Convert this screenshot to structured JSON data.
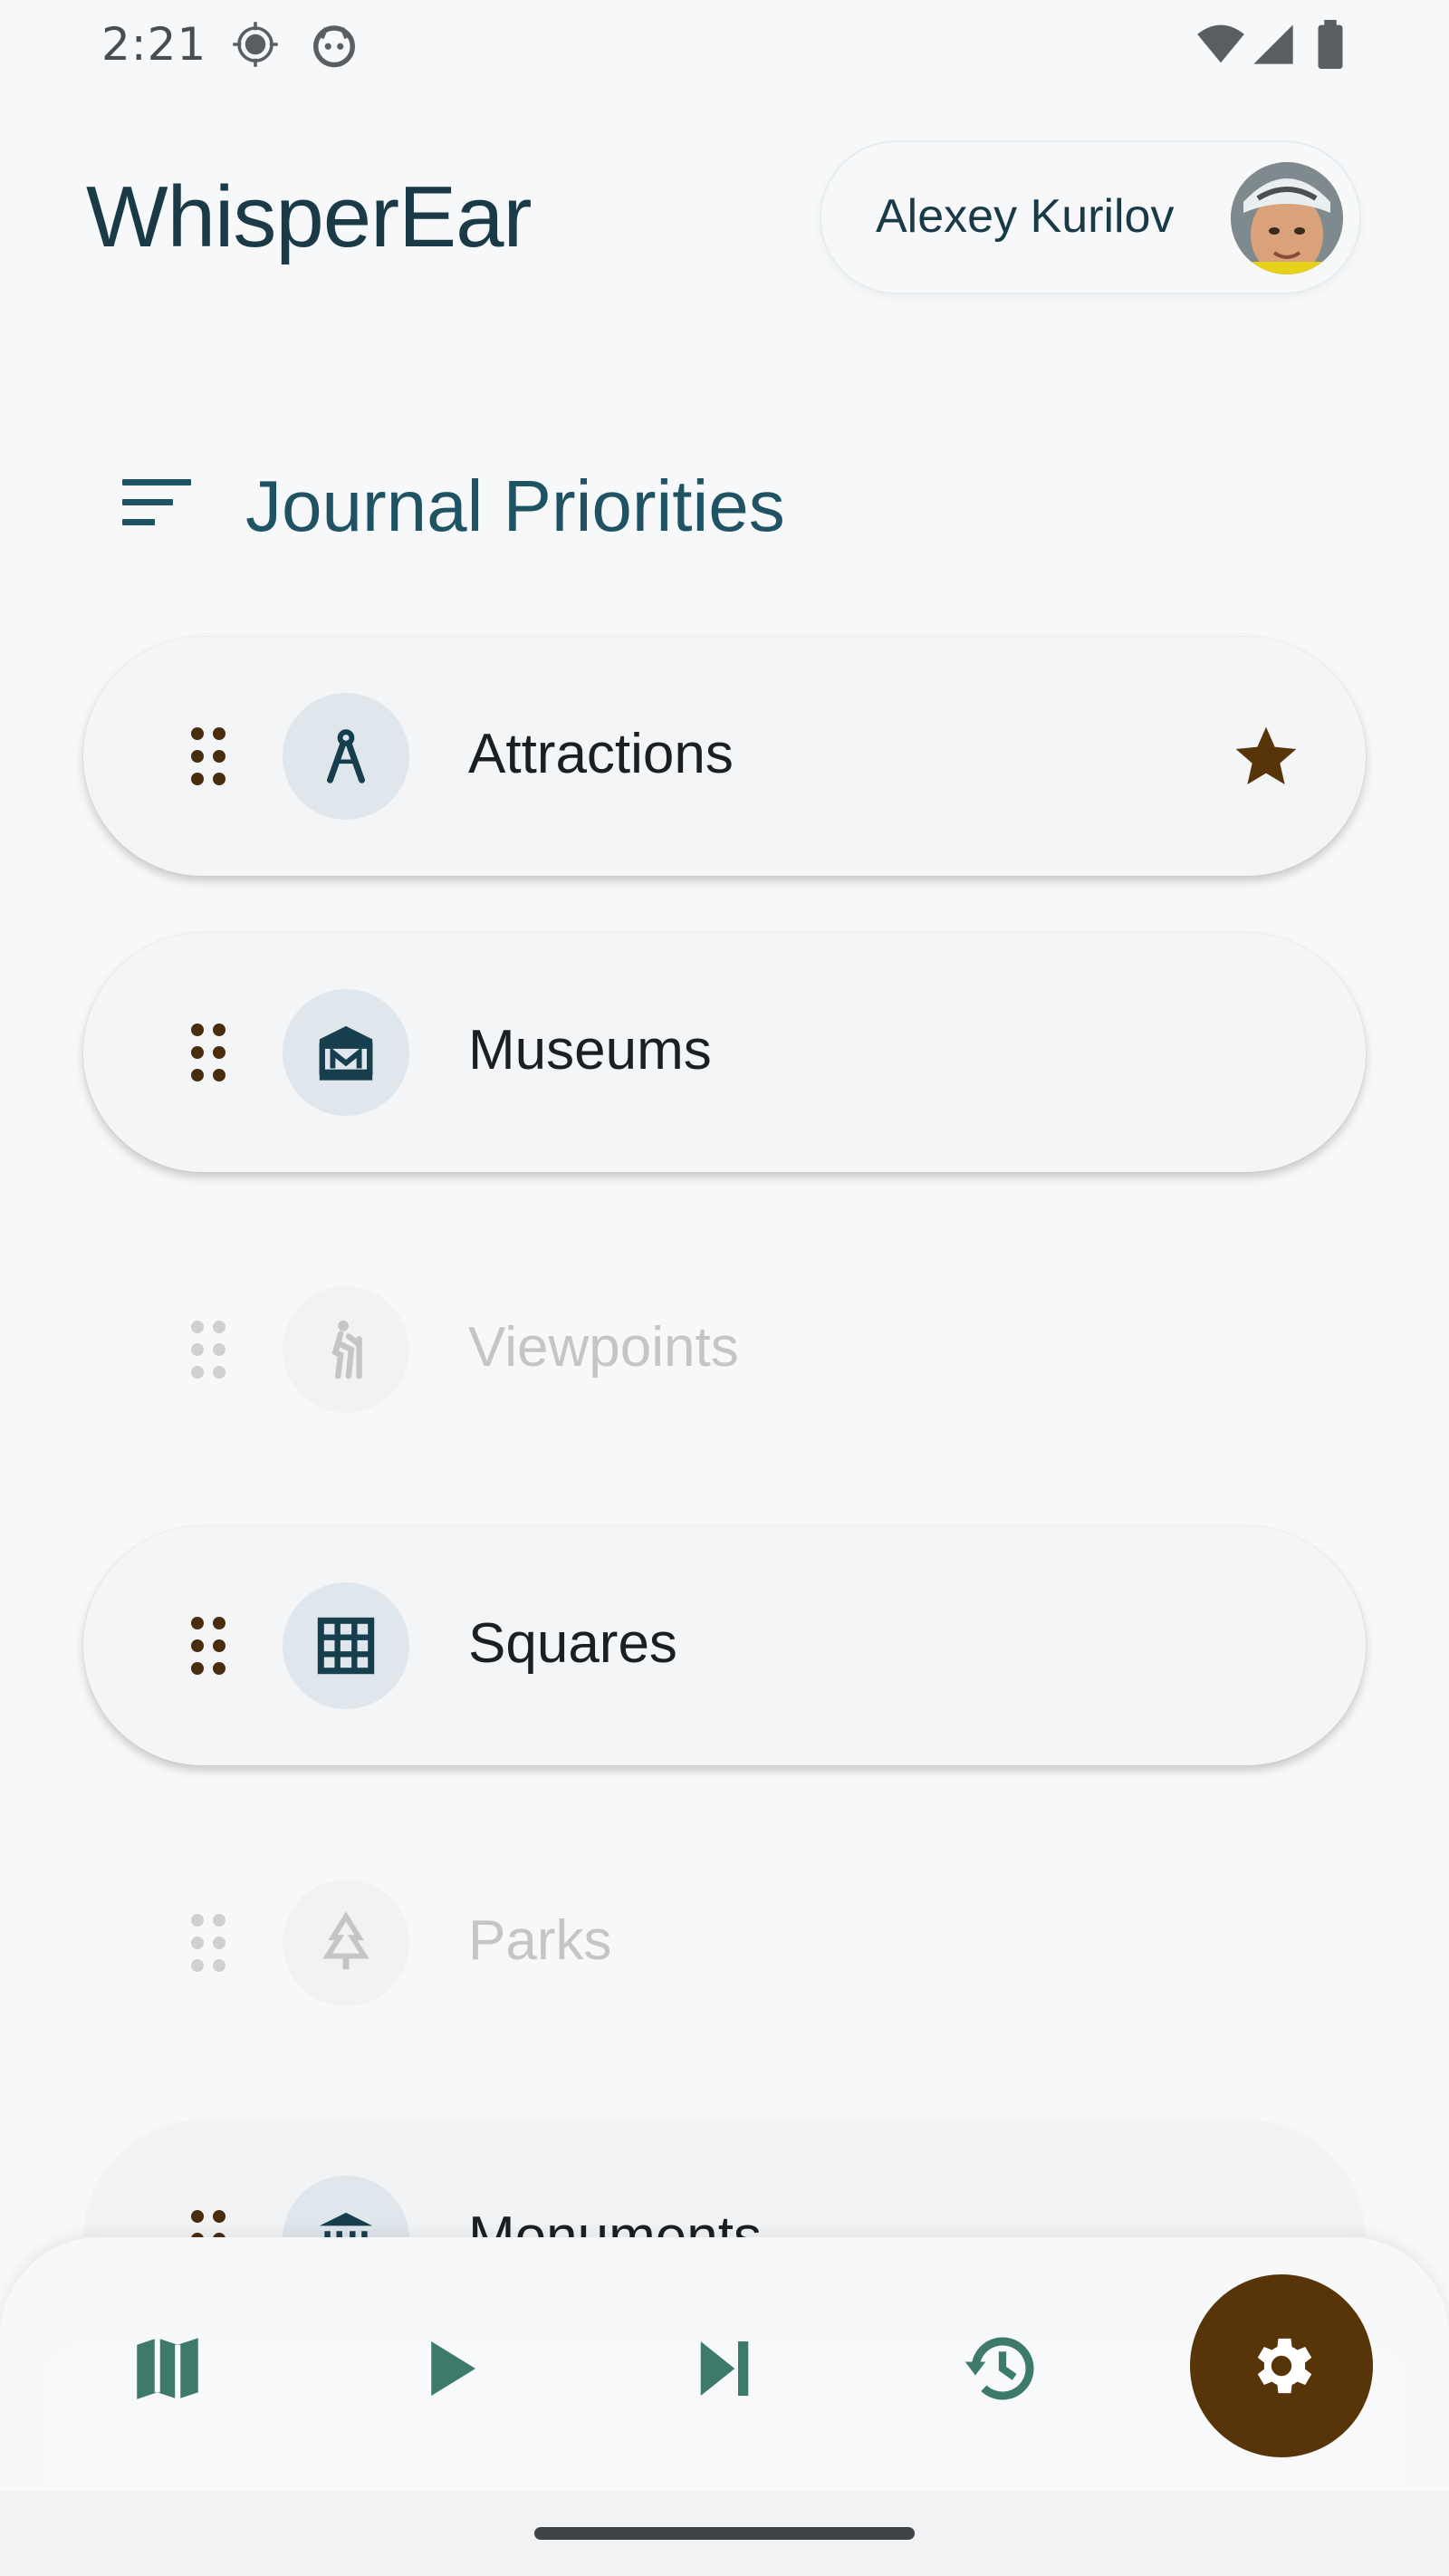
{
  "status_bar": {
    "time": "2:21",
    "icons": [
      "location-icon",
      "android-icon",
      "wifi-icon",
      "signal-icon",
      "battery-icon"
    ]
  },
  "header": {
    "app_title": "WhisperEar",
    "user_name": "Alexey Kurilov",
    "avatar": "avatar"
  },
  "section": {
    "title": "Journal Priorities",
    "icon": "sort-icon"
  },
  "priorities": [
    {
      "label": "Attractions",
      "icon": "compass-icon",
      "enabled": true,
      "starred": true
    },
    {
      "label": "Museums",
      "icon": "museum-icon",
      "enabled": true,
      "starred": false
    },
    {
      "label": "Viewpoints",
      "icon": "hiker-icon",
      "enabled": false,
      "starred": false
    },
    {
      "label": "Squares",
      "icon": "grid-icon",
      "enabled": true,
      "starred": false
    },
    {
      "label": "Parks",
      "icon": "tree-icon",
      "enabled": false,
      "starred": false
    },
    {
      "label": "Monuments",
      "icon": "monument-icon",
      "enabled": true,
      "starred": false
    }
  ],
  "bottom_nav": {
    "items": [
      "map-icon",
      "play-icon",
      "skip-next-icon",
      "history-icon",
      "settings-icon"
    ],
    "active": "settings"
  },
  "colors": {
    "accent_dark": "#1b3a48",
    "teal": "#1f5262",
    "nav_icon": "#3e7a6b",
    "fab": "#583409",
    "drag_handle": "#4a2c0f",
    "star": "#583409"
  }
}
